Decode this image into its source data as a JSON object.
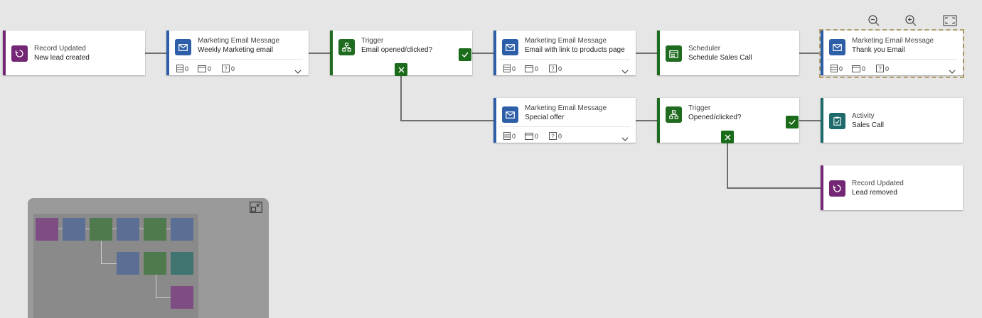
{
  "toolbar": {
    "zoom_out_icon": "zoom-out-icon",
    "zoom_in_icon": "zoom-in-icon",
    "fit_icon": "fit-to-screen-icon"
  },
  "tiles": {
    "record_updated_1": {
      "category": "Record Updated",
      "name": "New lead created",
      "icon": "refresh-icon",
      "color": "#742774"
    },
    "email_weekly": {
      "category": "Marketing Email Message",
      "name": "Weekly Marketing email",
      "icon": "email-icon",
      "color": "#2d5fa8",
      "stats": [
        "0",
        "0",
        "0"
      ]
    },
    "trigger_1": {
      "category": "Trigger",
      "name": "Email opened/clicked?",
      "icon": "trigger-icon",
      "color": "#1f6b1f"
    },
    "email_products": {
      "category": "Marketing Email Message",
      "name": "Email with link to products page",
      "icon": "email-icon",
      "color": "#2d5fa8",
      "stats": [
        "0",
        "0",
        "0"
      ]
    },
    "scheduler": {
      "category": "Scheduler",
      "name": "Schedule Sales Call",
      "icon": "calendar-icon",
      "color": "#1f6b1f"
    },
    "email_thanks": {
      "category": "Marketing Email Message",
      "name": "Thank you Email",
      "icon": "email-icon",
      "color": "#2d5fa8",
      "stats": [
        "0",
        "0",
        "0"
      ]
    },
    "email_special": {
      "category": "Marketing Email Message",
      "name": "Special offer",
      "icon": "email-icon",
      "color": "#2d5fa8",
      "stats": [
        "0",
        "0",
        "0"
      ]
    },
    "trigger_2": {
      "category": "Trigger",
      "name": "Opened/clicked?",
      "icon": "trigger-icon",
      "color": "#1f6b1f"
    },
    "activity": {
      "category": "Activity",
      "name": "Sales Call",
      "icon": "clipboard-icon",
      "color": "#1f6a6a"
    },
    "record_updated_2": {
      "category": "Record Updated",
      "name": "Lead removed",
      "icon": "refresh-icon",
      "color": "#742774"
    }
  },
  "minimap": {
    "collapse_icon": "collapse-minimap-icon",
    "colors": {
      "purple": "#7e4d83",
      "blue": "#5b6e94",
      "green": "#4f7a4d",
      "teal": "#3f7470"
    }
  }
}
